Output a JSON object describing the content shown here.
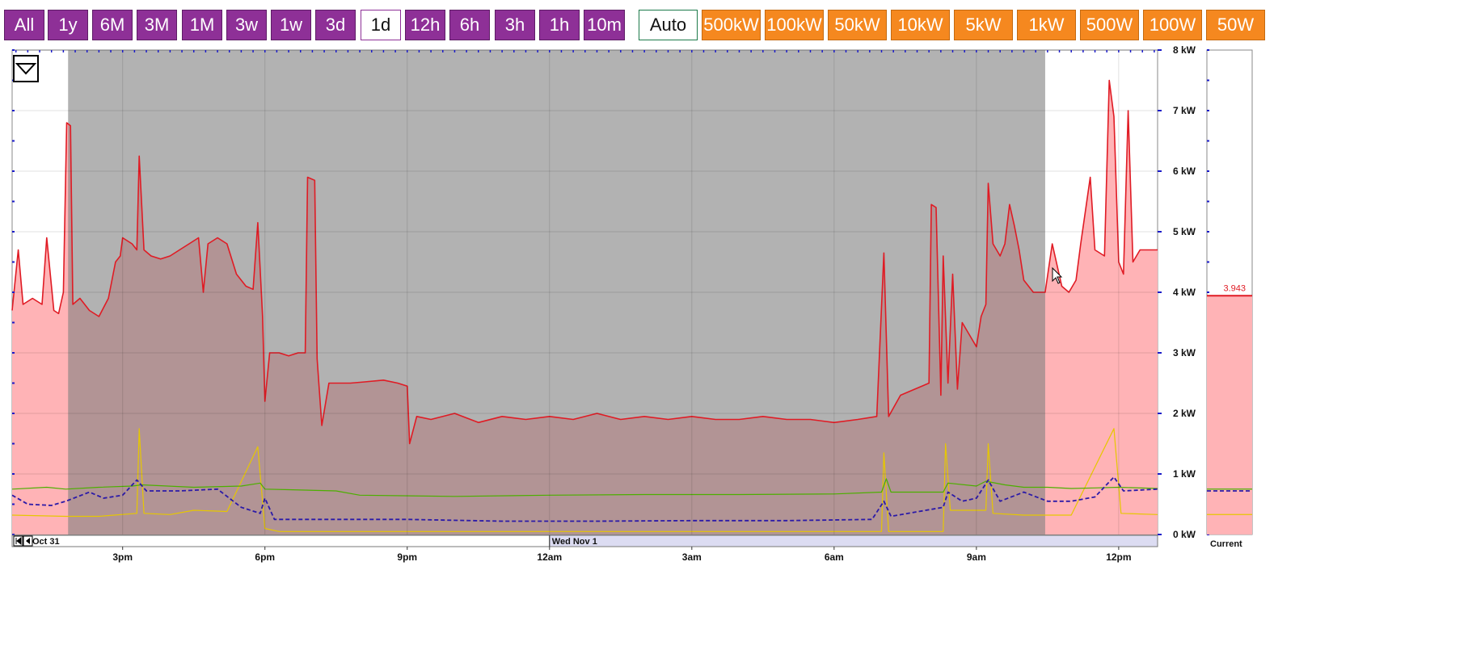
{
  "range_buttons": [
    {
      "label": "All"
    },
    {
      "label": "1y"
    },
    {
      "label": "6M"
    },
    {
      "label": "3M"
    },
    {
      "label": "1M"
    },
    {
      "label": "3w"
    },
    {
      "label": "1w"
    },
    {
      "label": "3d"
    },
    {
      "label": "1d",
      "selected": true
    },
    {
      "label": "12h"
    },
    {
      "label": "6h"
    },
    {
      "label": "3h"
    },
    {
      "label": "1h"
    },
    {
      "label": "10m"
    }
  ],
  "power_buttons": [
    {
      "label": "Auto",
      "selected": true
    },
    {
      "label": "500kW"
    },
    {
      "label": "100kW"
    },
    {
      "label": "50kW"
    },
    {
      "label": "10kW"
    },
    {
      "label": "5kW"
    },
    {
      "label": "1kW"
    },
    {
      "label": "500W"
    },
    {
      "label": "100W"
    },
    {
      "label": "50W"
    }
  ],
  "colors": {
    "range_button": "#8e3097",
    "power_button": "#f5881f",
    "total_line": "#e01b24",
    "total_fill": "#ffb3b6",
    "night_shade": "#7f7f7f",
    "green_series": "#4caf00",
    "yellow_series": "#e6c700",
    "dashed_series": "#2b1aa8"
  },
  "chart_data": {
    "type": "area",
    "ylim": [
      0,
      8
    ],
    "yticks": [
      "0 kW",
      "1 kW",
      "2 kW",
      "3 kW",
      "4 kW",
      "5 kW",
      "6 kW",
      "7 kW",
      "8 kW"
    ],
    "x_range_hours": [
      12.67,
      36.82
    ],
    "xticks": [
      {
        "h": 15,
        "label": "3pm"
      },
      {
        "h": 18,
        "label": "6pm"
      },
      {
        "h": 21,
        "label": "9pm"
      },
      {
        "h": 24,
        "label": "12am"
      },
      {
        "h": 27,
        "label": "3am"
      },
      {
        "h": 30,
        "label": "6am"
      },
      {
        "h": 33,
        "label": "9am"
      },
      {
        "h": 36,
        "label": "12pm"
      }
    ],
    "day_labels": [
      {
        "h": 12.67,
        "label": "Oct 31"
      },
      {
        "h": 24,
        "label": "Wed Nov 1"
      }
    ],
    "night_shade_hours": [
      13.85,
      34.45
    ],
    "current_label": "Current",
    "current_value": "3.943",
    "current": {
      "total": 3.943,
      "green": 0.75,
      "dashed": 0.72,
      "yellow": 0.33
    },
    "series": [
      {
        "key": "total",
        "points": [
          [
            12.67,
            3.7
          ],
          [
            12.8,
            4.7
          ],
          [
            12.9,
            3.8
          ],
          [
            13.1,
            3.9
          ],
          [
            13.3,
            3.8
          ],
          [
            13.4,
            4.9
          ],
          [
            13.55,
            3.7
          ],
          [
            13.65,
            3.65
          ],
          [
            13.75,
            4.0
          ],
          [
            13.82,
            6.8
          ],
          [
            13.9,
            6.75
          ],
          [
            13.95,
            3.8
          ],
          [
            14.1,
            3.9
          ],
          [
            14.3,
            3.7
          ],
          [
            14.5,
            3.6
          ],
          [
            14.7,
            3.9
          ],
          [
            14.85,
            4.5
          ],
          [
            14.95,
            4.6
          ],
          [
            15.0,
            4.9
          ],
          [
            15.2,
            4.8
          ],
          [
            15.3,
            4.7
          ],
          [
            15.35,
            6.25
          ],
          [
            15.45,
            4.7
          ],
          [
            15.6,
            4.6
          ],
          [
            15.8,
            4.55
          ],
          [
            16.0,
            4.6
          ],
          [
            16.2,
            4.7
          ],
          [
            16.4,
            4.8
          ],
          [
            16.6,
            4.9
          ],
          [
            16.7,
            4.0
          ],
          [
            16.8,
            4.8
          ],
          [
            17.0,
            4.9
          ],
          [
            17.2,
            4.8
          ],
          [
            17.4,
            4.3
          ],
          [
            17.6,
            4.1
          ],
          [
            17.75,
            4.05
          ],
          [
            17.85,
            5.15
          ],
          [
            17.95,
            3.6
          ],
          [
            18.0,
            2.2
          ],
          [
            18.1,
            3.0
          ],
          [
            18.3,
            3.0
          ],
          [
            18.5,
            2.95
          ],
          [
            18.7,
            3.0
          ],
          [
            18.85,
            3.0
          ],
          [
            18.9,
            5.9
          ],
          [
            19.05,
            5.85
          ],
          [
            19.1,
            2.9
          ],
          [
            19.2,
            1.8
          ],
          [
            19.35,
            2.5
          ],
          [
            19.5,
            2.5
          ],
          [
            19.8,
            2.5
          ],
          [
            20.1,
            2.52
          ],
          [
            20.5,
            2.55
          ],
          [
            20.8,
            2.5
          ],
          [
            21.0,
            2.45
          ],
          [
            21.05,
            1.5
          ],
          [
            21.2,
            1.95
          ],
          [
            21.5,
            1.9
          ],
          [
            22.0,
            2.0
          ],
          [
            22.5,
            1.85
          ],
          [
            23.0,
            1.95
          ],
          [
            23.5,
            1.9
          ],
          [
            24.0,
            1.95
          ],
          [
            24.5,
            1.9
          ],
          [
            25.0,
            2.0
          ],
          [
            25.5,
            1.9
          ],
          [
            26.0,
            1.95
          ],
          [
            26.5,
            1.9
          ],
          [
            27.0,
            1.95
          ],
          [
            27.5,
            1.9
          ],
          [
            28.0,
            1.9
          ],
          [
            28.5,
            1.95
          ],
          [
            29.0,
            1.9
          ],
          [
            29.5,
            1.9
          ],
          [
            30.0,
            1.85
          ],
          [
            30.5,
            1.9
          ],
          [
            30.9,
            1.95
          ],
          [
            31.05,
            4.65
          ],
          [
            31.15,
            1.95
          ],
          [
            31.4,
            2.3
          ],
          [
            31.7,
            2.4
          ],
          [
            32.0,
            2.5
          ],
          [
            32.05,
            5.45
          ],
          [
            32.15,
            5.4
          ],
          [
            32.25,
            2.3
          ],
          [
            32.3,
            4.6
          ],
          [
            32.4,
            2.5
          ],
          [
            32.5,
            4.3
          ],
          [
            32.6,
            2.4
          ],
          [
            32.7,
            3.5
          ],
          [
            32.85,
            3.3
          ],
          [
            33.0,
            3.1
          ],
          [
            33.1,
            3.6
          ],
          [
            33.2,
            3.8
          ],
          [
            33.25,
            5.8
          ],
          [
            33.35,
            4.8
          ],
          [
            33.5,
            4.6
          ],
          [
            33.6,
            4.8
          ],
          [
            33.7,
            5.45
          ],
          [
            33.8,
            5.1
          ],
          [
            33.9,
            4.7
          ],
          [
            34.0,
            4.2
          ],
          [
            34.2,
            4.0
          ],
          [
            34.45,
            4.0
          ],
          [
            34.6,
            4.8
          ],
          [
            34.8,
            4.1
          ],
          [
            34.95,
            4.0
          ],
          [
            35.1,
            4.2
          ],
          [
            35.2,
            4.8
          ],
          [
            35.4,
            5.9
          ],
          [
            35.5,
            4.7
          ],
          [
            35.7,
            4.6
          ],
          [
            35.8,
            7.5
          ],
          [
            35.9,
            6.9
          ],
          [
            36.0,
            4.5
          ],
          [
            36.1,
            4.3
          ],
          [
            36.2,
            7.0
          ],
          [
            36.3,
            4.5
          ],
          [
            36.45,
            4.7
          ],
          [
            36.6,
            4.7
          ],
          [
            36.82,
            4.7
          ]
        ]
      },
      {
        "key": "green",
        "points": [
          [
            12.67,
            0.75
          ],
          [
            13.4,
            0.78
          ],
          [
            13.8,
            0.75
          ],
          [
            14.5,
            0.78
          ],
          [
            15.2,
            0.8
          ],
          [
            15.4,
            0.82
          ],
          [
            16.5,
            0.78
          ],
          [
            17.5,
            0.8
          ],
          [
            17.9,
            0.85
          ],
          [
            18.0,
            0.75
          ],
          [
            18.5,
            0.74
          ],
          [
            19.5,
            0.72
          ],
          [
            20.0,
            0.65
          ],
          [
            22.0,
            0.63
          ],
          [
            24.0,
            0.65
          ],
          [
            26.0,
            0.66
          ],
          [
            28.0,
            0.66
          ],
          [
            30.0,
            0.67
          ],
          [
            31.0,
            0.7
          ],
          [
            31.1,
            0.92
          ],
          [
            31.2,
            0.7
          ],
          [
            32.3,
            0.7
          ],
          [
            32.4,
            0.85
          ],
          [
            33.0,
            0.8
          ],
          [
            33.2,
            0.88
          ],
          [
            33.6,
            0.82
          ],
          [
            34.0,
            0.78
          ],
          [
            34.5,
            0.78
          ],
          [
            35.0,
            0.76
          ],
          [
            35.5,
            0.77
          ],
          [
            36.0,
            0.78
          ],
          [
            36.82,
            0.76
          ]
        ]
      },
      {
        "key": "dashed",
        "points": [
          [
            12.67,
            0.65
          ],
          [
            13.0,
            0.5
          ],
          [
            13.5,
            0.48
          ],
          [
            13.8,
            0.55
          ],
          [
            14.3,
            0.7
          ],
          [
            14.6,
            0.6
          ],
          [
            15.0,
            0.65
          ],
          [
            15.3,
            0.9
          ],
          [
            15.5,
            0.72
          ],
          [
            16.2,
            0.72
          ],
          [
            17.0,
            0.75
          ],
          [
            17.5,
            0.45
          ],
          [
            17.9,
            0.35
          ],
          [
            18.0,
            0.6
          ],
          [
            18.2,
            0.25
          ],
          [
            19.0,
            0.25
          ],
          [
            21.0,
            0.25
          ],
          [
            23.0,
            0.22
          ],
          [
            25.0,
            0.22
          ],
          [
            27.0,
            0.23
          ],
          [
            29.0,
            0.23
          ],
          [
            30.8,
            0.25
          ],
          [
            31.05,
            0.55
          ],
          [
            31.2,
            0.3
          ],
          [
            32.3,
            0.45
          ],
          [
            32.4,
            0.7
          ],
          [
            32.7,
            0.55
          ],
          [
            33.0,
            0.6
          ],
          [
            33.25,
            0.9
          ],
          [
            33.5,
            0.55
          ],
          [
            34.0,
            0.7
          ],
          [
            34.5,
            0.55
          ],
          [
            35.0,
            0.55
          ],
          [
            35.5,
            0.62
          ],
          [
            35.9,
            0.95
          ],
          [
            36.1,
            0.72
          ],
          [
            36.82,
            0.75
          ]
        ]
      },
      {
        "key": "yellow",
        "points": [
          [
            12.67,
            0.32
          ],
          [
            13.8,
            0.3
          ],
          [
            14.5,
            0.3
          ],
          [
            15.3,
            0.35
          ],
          [
            15.35,
            1.75
          ],
          [
            15.45,
            0.35
          ],
          [
            16.0,
            0.33
          ],
          [
            16.5,
            0.4
          ],
          [
            17.2,
            0.38
          ],
          [
            17.85,
            1.45
          ],
          [
            18.0,
            0.1
          ],
          [
            18.3,
            0.05
          ],
          [
            22.0,
            0.05
          ],
          [
            26.0,
            0.05
          ],
          [
            30.0,
            0.05
          ],
          [
            31.0,
            0.05
          ],
          [
            31.05,
            1.35
          ],
          [
            31.15,
            0.05
          ],
          [
            32.3,
            0.05
          ],
          [
            32.35,
            1.5
          ],
          [
            32.45,
            0.4
          ],
          [
            33.2,
            0.4
          ],
          [
            33.25,
            1.5
          ],
          [
            33.35,
            0.35
          ],
          [
            34.0,
            0.32
          ],
          [
            35.0,
            0.32
          ],
          [
            35.9,
            1.75
          ],
          [
            36.05,
            0.35
          ],
          [
            36.82,
            0.33
          ]
        ]
      }
    ]
  }
}
